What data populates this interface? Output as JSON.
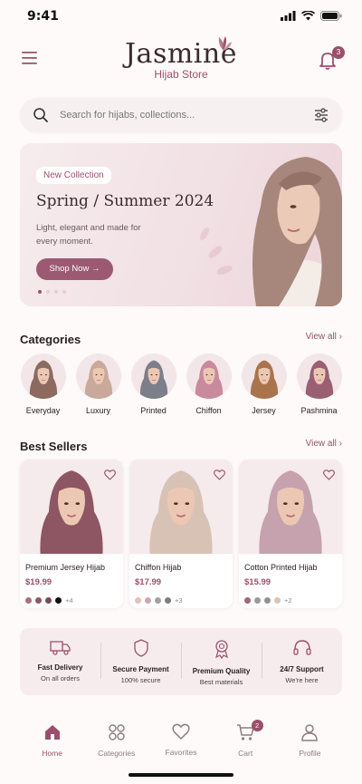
{
  "status": {
    "time": "9:41"
  },
  "header": {
    "brand": "Jasmine",
    "sub": "Hijab Store",
    "notif_count": "3"
  },
  "search": {
    "placeholder": "Search for hijabs, collections..."
  },
  "hero": {
    "pill": "New Collection",
    "title": "Spring / Summer 2024",
    "desc": "Light, elegant and made for every moment.",
    "button": "Shop Now →",
    "slide_count": 4,
    "active_slide": 1
  },
  "categories": {
    "title": "Categories",
    "view_all": "View all",
    "items": [
      {
        "label": "Everyday",
        "color": "#8c6a60"
      },
      {
        "label": "Luxury",
        "color": "#c9a99a"
      },
      {
        "label": "Printed",
        "color": "#7c7e8a"
      },
      {
        "label": "Chiffon",
        "color": "#c98a9e"
      },
      {
        "label": "Jersey",
        "color": "#a9744c"
      },
      {
        "label": "Pashmina",
        "color": "#9a5f73"
      }
    ]
  },
  "best_sellers": {
    "title": "Best Sellers",
    "view_all": "View all",
    "items": [
      {
        "name": "Premium Jersey Hijab",
        "price": "$19.99",
        "more": "+4",
        "color": "#8d5662",
        "swatches": [
          "#a8707d",
          "#8c5a66",
          "#7a4c55",
          "#111111"
        ]
      },
      {
        "name": "Chiffon Hijab",
        "price": "$17.99",
        "more": "+3",
        "color": "#d8c2b6",
        "swatches": [
          "#e0c2b8",
          "#caa8b0",
          "#a2a0a2",
          "#7d7d7d"
        ]
      },
      {
        "name": "Cotton Printed Hijab",
        "price": "$15.99",
        "more": "+2",
        "color": "#c5a2ae",
        "swatches": [
          "#a06778",
          "#9b9b9b",
          "#8f9393",
          "#d9c3b6"
        ]
      }
    ]
  },
  "features": [
    {
      "title": "Fast Delivery",
      "sub": "On all orders",
      "icon": "truck-icon"
    },
    {
      "title": "Secure Payment",
      "sub": "100% secure",
      "icon": "shield-icon"
    },
    {
      "title": "Premium Quality",
      "sub": "Best materials",
      "icon": "badge-icon"
    },
    {
      "title": "24/7 Support",
      "sub": "We're here",
      "icon": "headset-icon"
    }
  ],
  "tabs": [
    {
      "label": "Home",
      "icon": "home-icon",
      "active": true
    },
    {
      "label": "Categories",
      "icon": "grid-icon"
    },
    {
      "label": "Favorites",
      "icon": "heart-icon"
    },
    {
      "label": "Cart",
      "icon": "cart-icon",
      "badge": "2"
    },
    {
      "label": "Profile",
      "icon": "user-icon"
    }
  ],
  "colors": {
    "accent": "#9c4f6c",
    "background": "#fdfaf9"
  }
}
